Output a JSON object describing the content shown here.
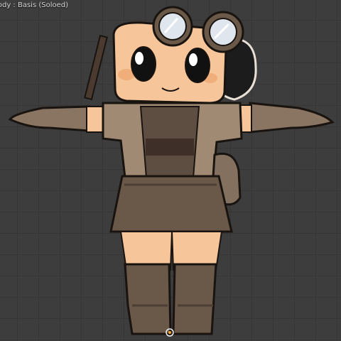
{
  "viewport": {
    "overlay_label": "Body : Basis (Soloed)"
  },
  "icons": {
    "origin": "origin-pivot-icon"
  },
  "colors": {
    "background": "#3d3d3d",
    "grid": "#363636",
    "skin": "#f6c69a",
    "brown_dark": "#5e4e42",
    "brown_mid": "#84705e",
    "brown_light": "#a59079",
    "outline": "#1a1410",
    "goggle_lens": "#dfe6ee",
    "hair": "#1c1c1c"
  }
}
